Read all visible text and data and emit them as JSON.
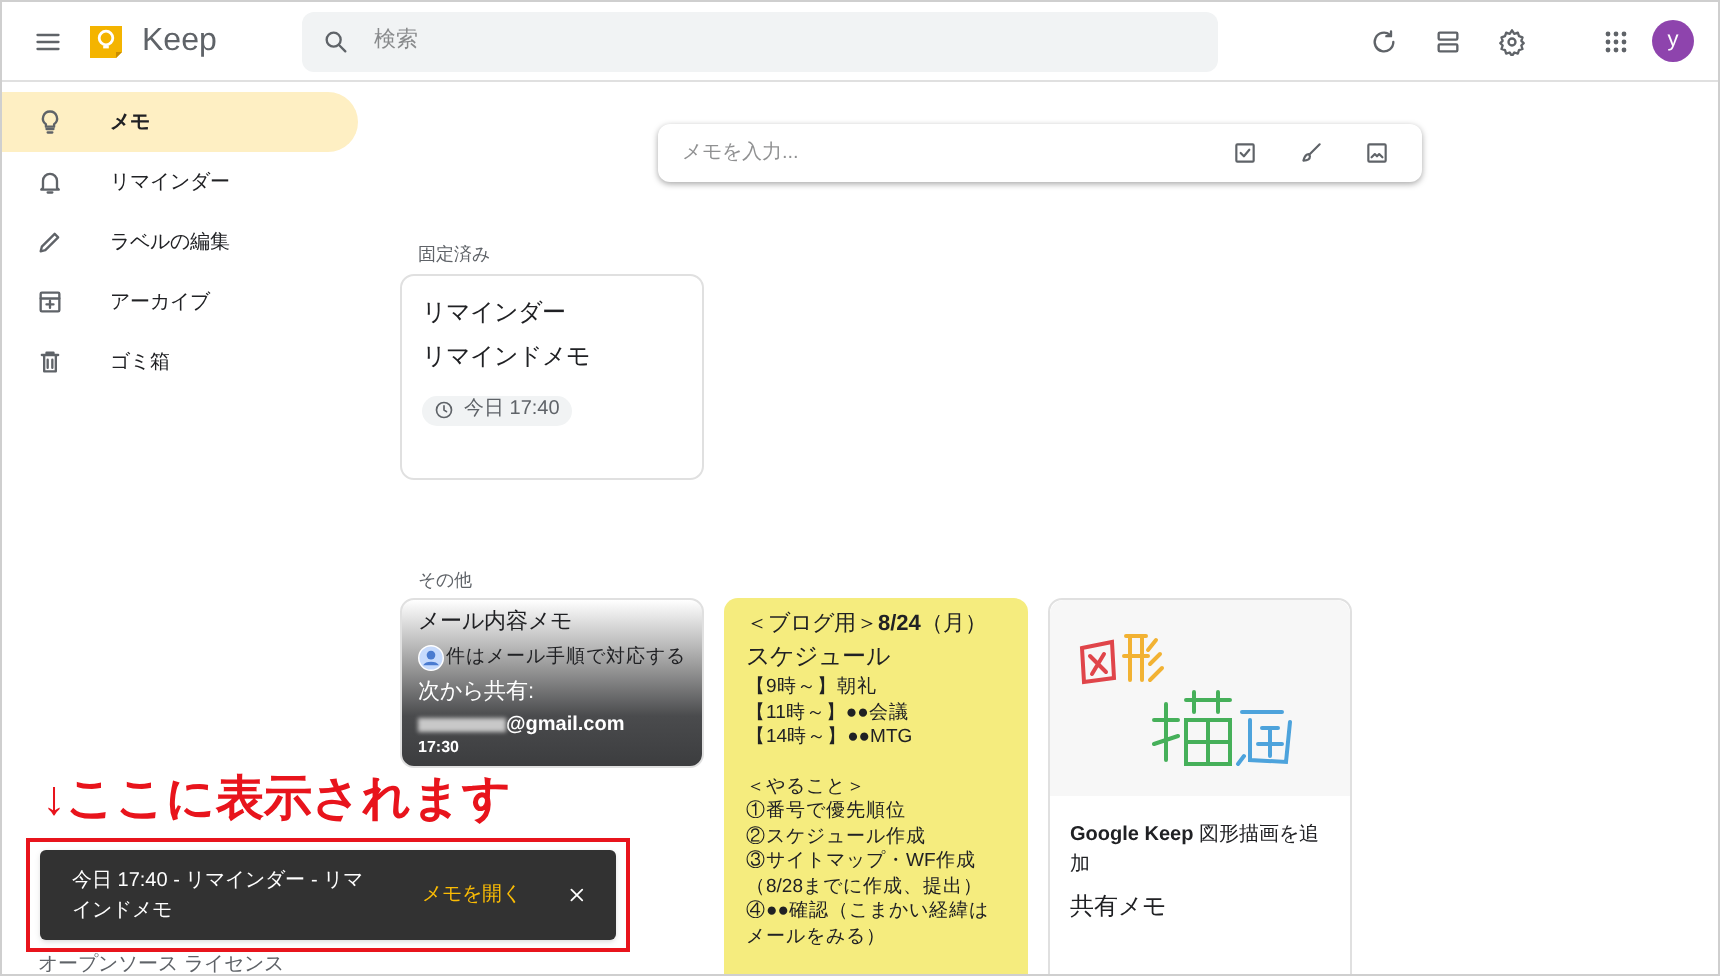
{
  "header": {
    "app_name": "Keep",
    "search": {
      "placeholder": "検索"
    },
    "avatar_letter": "y"
  },
  "sidebar": {
    "items": [
      {
        "label": "メモ",
        "selected": true
      },
      {
        "label": "リマインダー",
        "selected": false
      },
      {
        "label": "ラベルの編集",
        "selected": false
      },
      {
        "label": "アーカイブ",
        "selected": false
      },
      {
        "label": "ゴミ箱",
        "selected": false
      }
    ]
  },
  "compose": {
    "placeholder": "メモを入力..."
  },
  "pinned": {
    "label": "固定済み",
    "notes": [
      {
        "kind": "reminder",
        "color": "#ffffff",
        "title": "リマインダー",
        "body": "リマインドメモ",
        "reminder": "今日 17:40"
      }
    ]
  },
  "others": {
    "label": "その他",
    "notes": [
      {
        "kind": "shared",
        "color": "#ffffff",
        "title": "メール内容メモ",
        "body": "件はメール手順で対応する",
        "shared_label": "次から共有:",
        "email": "@gmail.com",
        "time": "17:30"
      },
      {
        "kind": "list",
        "color": "#f5ec7e",
        "title": "＜ブログ用＞**8/24**（月）",
        "subtitle": "スケジュール",
        "schedule": [
          "【9時～】朝礼",
          "【11時～】●●会議",
          "【14時～】●●MTG"
        ],
        "todo": [
          "＜やること＞",
          "①番号で優先順位",
          "②スケジュール作成",
          "③サイトマップ・WF作成",
          "（8/28までに作成、提出）",
          "④●●確認（こまかい経緯はメールをみる）"
        ]
      },
      {
        "kind": "drawing",
        "color": "#ffffff",
        "caption": "**Google Keep** 図形描画を追加",
        "title": "共有メモ"
      }
    ]
  },
  "annotation": {
    "text": "↓ここに表示されます"
  },
  "snackbar": {
    "message": "今日 17:40 - リマインダー - リマインドメモ",
    "action": "メモを開く"
  },
  "footer": {
    "link": "オープンソース ライセンス"
  }
}
